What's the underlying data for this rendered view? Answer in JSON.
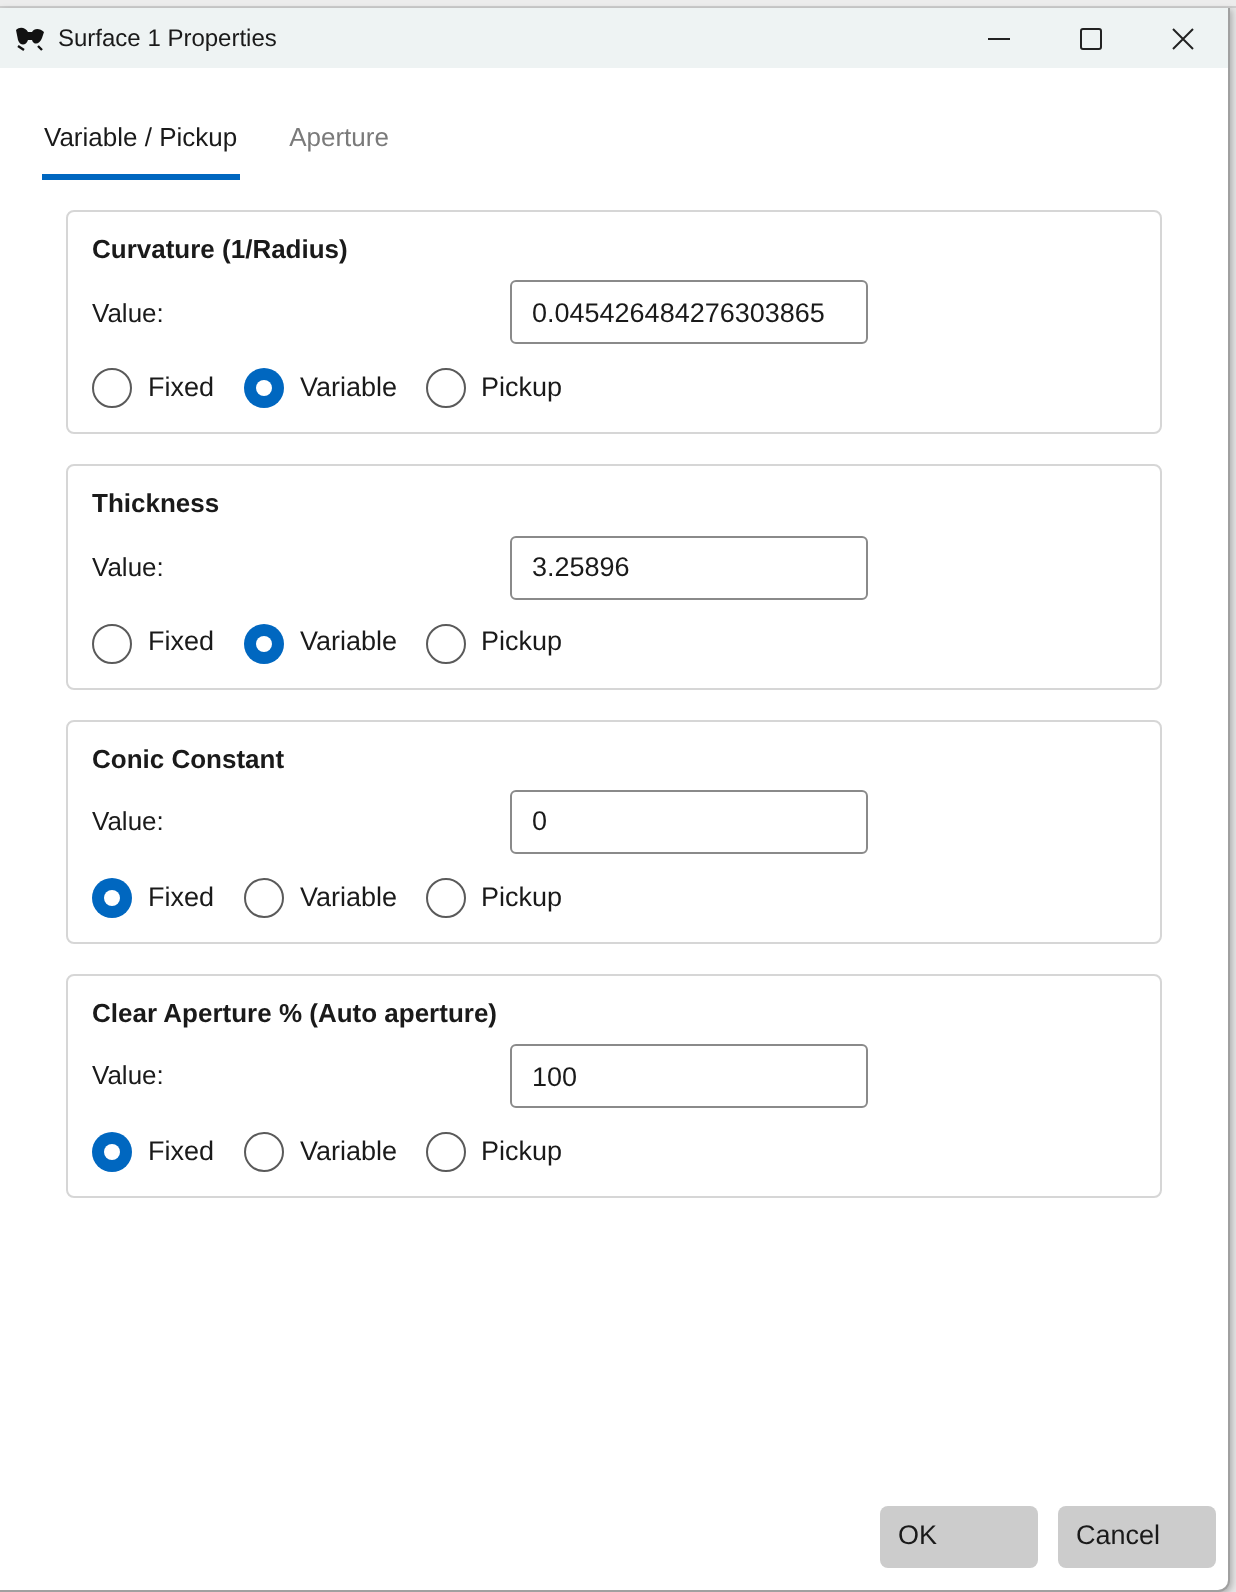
{
  "window": {
    "title": "Surface 1 Properties"
  },
  "tabs": [
    {
      "label": "Variable / Pickup",
      "selected": true
    },
    {
      "label": "Aperture",
      "selected": false
    }
  ],
  "groups": [
    {
      "title": "Curvature (1/Radius)",
      "value_label": "Value:",
      "value": "0.045426484276303865",
      "options": [
        {
          "label": "Fixed",
          "selected": false
        },
        {
          "label": "Variable",
          "selected": true
        },
        {
          "label": "Pickup",
          "selected": false
        }
      ]
    },
    {
      "title": "Thickness",
      "value_label": "Value:",
      "value": "3.25896",
      "options": [
        {
          "label": "Fixed",
          "selected": false
        },
        {
          "label": "Variable",
          "selected": true
        },
        {
          "label": "Pickup",
          "selected": false
        }
      ]
    },
    {
      "title": "Conic Constant",
      "value_label": "Value:",
      "value": "0",
      "options": [
        {
          "label": "Fixed",
          "selected": true
        },
        {
          "label": "Variable",
          "selected": false
        },
        {
          "label": "Pickup",
          "selected": false
        }
      ]
    },
    {
      "title": "Clear Aperture % (Auto aperture)",
      "value_label": "Value:",
      "value": "100",
      "options": [
        {
          "label": "Fixed",
          "selected": true
        },
        {
          "label": "Variable",
          "selected": false
        },
        {
          "label": "Pickup",
          "selected": false
        }
      ]
    }
  ],
  "buttons": [
    "OK",
    "Cancel"
  ]
}
